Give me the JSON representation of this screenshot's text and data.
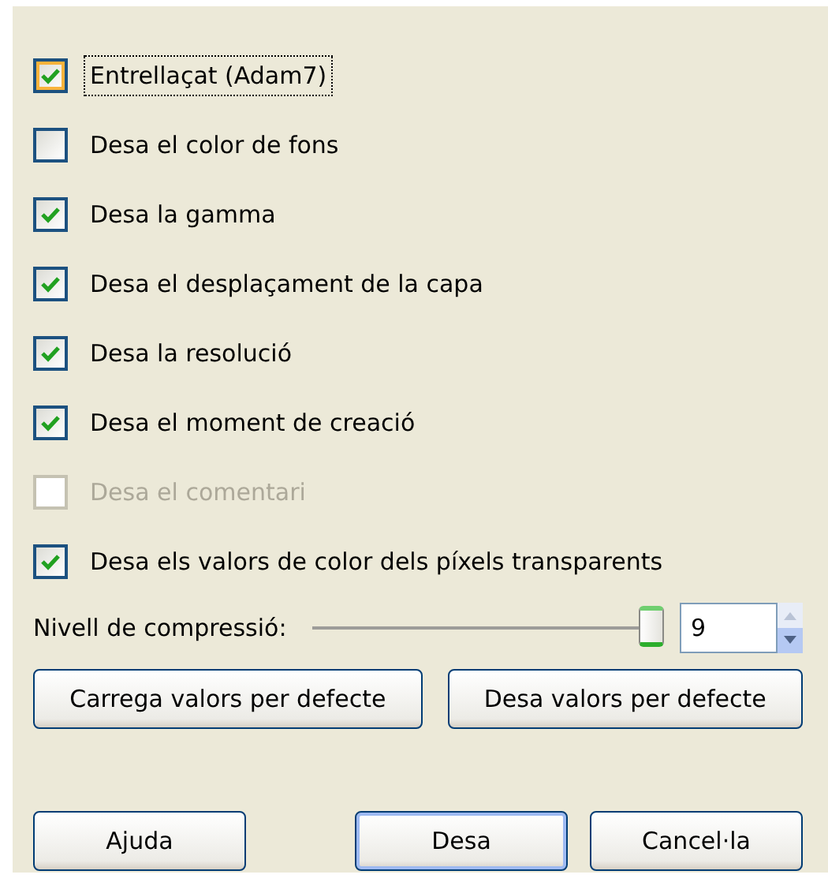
{
  "options": [
    {
      "label": "Entrellaçat (Adam7)",
      "checked": true,
      "disabled": false,
      "focused": true
    },
    {
      "label": "Desa el color de fons",
      "checked": false,
      "disabled": false,
      "focused": false
    },
    {
      "label": "Desa la gamma",
      "checked": true,
      "disabled": false,
      "focused": false
    },
    {
      "label": "Desa el desplaçament de la capa",
      "checked": true,
      "disabled": false,
      "focused": false
    },
    {
      "label": "Desa la resolució",
      "checked": true,
      "disabled": false,
      "focused": false
    },
    {
      "label": "Desa el moment de creació",
      "checked": true,
      "disabled": false,
      "focused": false
    },
    {
      "label": "Desa el comentari",
      "checked": false,
      "disabled": true,
      "focused": false
    },
    {
      "label": "Desa els valors de color dels píxels transparents",
      "checked": true,
      "disabled": false,
      "focused": false
    }
  ],
  "compression": {
    "label": "Nivell de compressió:",
    "level": 1,
    "value": "9"
  },
  "default_buttons": [
    "Carrega valors per defecte",
    "Desa valors per defecte"
  ],
  "buttons": [
    {
      "label": "Ajuda",
      "default": false
    },
    {
      "label": "Desa",
      "default": true
    },
    {
      "label": "Cancel·la",
      "default": false
    }
  ]
}
